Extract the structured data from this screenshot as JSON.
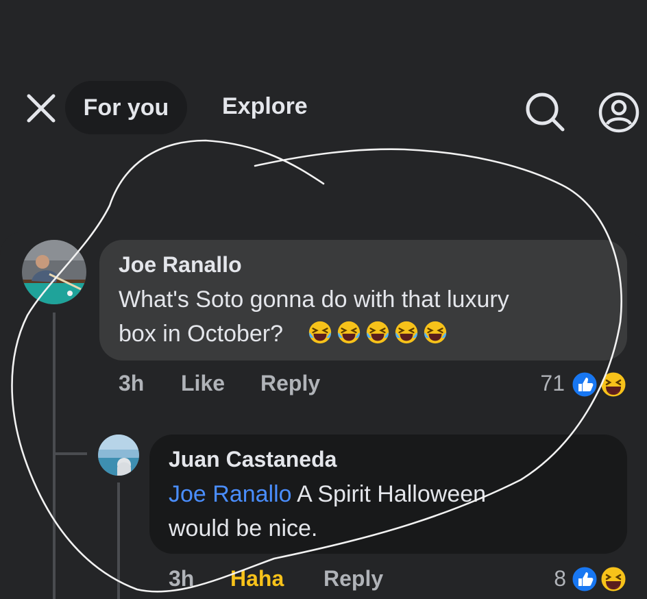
{
  "header": {
    "tab_for_you": "For you",
    "tab_explore": "Explore",
    "icons": [
      "close-icon",
      "search-icon",
      "profile-icon"
    ]
  },
  "comments": [
    {
      "author": "Joe Ranallo",
      "text_line1": "What's Soto gonna do with that luxury",
      "text_line2": "box in October?",
      "emoji": [
        "laughing-tears-emoji",
        "laughing-tears-emoji",
        "laughing-tears-emoji",
        "laughing-tears-emoji",
        "laughing-tears-emoji"
      ],
      "time": "3h",
      "like_label": "Like",
      "reply_label": "Reply",
      "reaction_count": "71",
      "reactions": [
        "like-reaction-icon",
        "haha-reaction-icon"
      ]
    },
    {
      "author": "Juan Castaneda",
      "mention": "Joe Ranallo",
      "text_line1_rest": " A Spirit Halloween",
      "text_line2": "would be nice.",
      "time": "3h",
      "reaction_label": "Haha",
      "reply_label": "Reply",
      "reaction_count": "8",
      "reactions": [
        "like-reaction-icon",
        "haha-reaction-icon"
      ]
    }
  ],
  "colors": {
    "background": "#242527",
    "bubble_primary": "#3a3b3c",
    "bubble_reply": "#18191a",
    "mention": "#4a8eff",
    "haha_active": "#f7c21a",
    "like_blue": "#1877f2"
  }
}
